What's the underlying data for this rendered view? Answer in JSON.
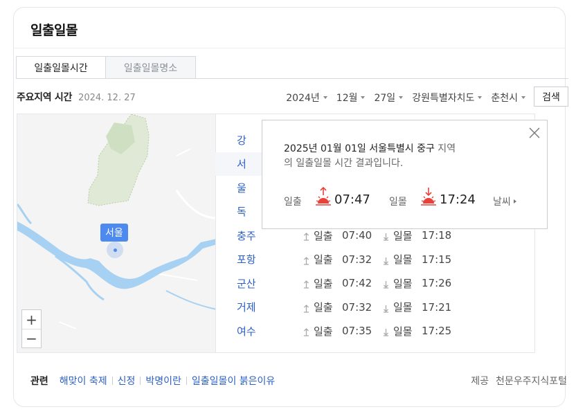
{
  "card_title": "일출일몰",
  "tabs": [
    {
      "label": "일출일몰시간",
      "active": true
    },
    {
      "label": "일출일몰명소",
      "active": false
    }
  ],
  "subhead": {
    "title": "주요지역 시간",
    "date": "2024. 12. 27"
  },
  "selects": {
    "year": "2024년",
    "month": "12월",
    "day": "27일",
    "province": "강원특별자치도",
    "city": "춘천시"
  },
  "search_button": "검색",
  "map": {
    "pin_label": "서울",
    "zoom_in": "+",
    "zoom_out": "−"
  },
  "labels": {
    "rise": "일출",
    "set": "일몰"
  },
  "rows": [
    {
      "city": "강",
      "rise": "",
      "set": ""
    },
    {
      "city": "서",
      "rise": "",
      "set": ""
    },
    {
      "city": "울",
      "rise": "",
      "set": ""
    },
    {
      "city": "독",
      "rise": "",
      "set": ""
    },
    {
      "city": "충주",
      "rise": "07:40",
      "set": "17:18"
    },
    {
      "city": "포항",
      "rise": "07:32",
      "set": "17:15"
    },
    {
      "city": "군산",
      "rise": "07:42",
      "set": "17:26"
    },
    {
      "city": "거제",
      "rise": "07:32",
      "set": "17:21"
    },
    {
      "city": "여수",
      "rise": "07:35",
      "set": "17:25"
    }
  ],
  "popup": {
    "line1_main": "2025년 01월 01일 서울특별시 중구",
    "line1_suffix": " 지역",
    "line2": "의 일출일몰 시간 결과입니다.",
    "rise_label": "일출",
    "rise_time": "07:47",
    "set_label": "일몰",
    "set_time": "17:24",
    "weather_link": "날씨"
  },
  "footer": {
    "title": "관련",
    "links": [
      "해맞이 축제",
      "신정",
      "박명이란",
      "일출일몰이 붉은이유"
    ],
    "provider_label": "제공",
    "provider_name": "천문우주지식포털"
  },
  "colors": {
    "link": "#2b5fc4",
    "pin": "#4c8af0",
    "sun": "#e8413a",
    "river": "#a6d1f2",
    "forest": "#dde9d3"
  }
}
